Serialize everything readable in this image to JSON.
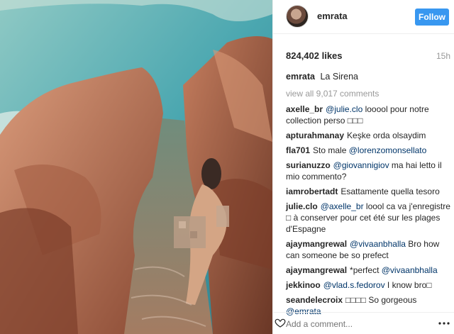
{
  "post": {
    "username": "emrata",
    "follow_label": "Follow",
    "likes": "824,402 likes",
    "time": "15h",
    "caption_user": "emrata",
    "caption_text": "La Sirena",
    "view_all": "view all 9,017 comments",
    "add_comment_placeholder": "Add a comment..."
  },
  "comments": [
    {
      "user": "axelle_br",
      "mention": "@julie.clo",
      "text": " looool pour notre collection perso □□□"
    },
    {
      "user": "apturahmanay",
      "mention": "",
      "text": "Keşke orda olsaydim"
    },
    {
      "user": "fla701",
      "mention": "@lorenzomonsellato",
      "text_before": "Sto male ",
      "text": ""
    },
    {
      "user": "surianuzzo",
      "mention": "@giovannigiov",
      "text": " ma hai letto il mio commento?"
    },
    {
      "user": "iamrobertadt",
      "mention": "",
      "text": "Esattamente quella tesoro"
    },
    {
      "user": "julie.clo",
      "mention": "@axelle_br",
      "text": " loool ca va j'enregistre □ à conserver pour cet été sur les plages d'Espagne"
    },
    {
      "user": "ajaymangrewal",
      "mention": "@vivaanbhalla",
      "text": " Bro how can someone be so prefect"
    },
    {
      "user": "ajaymangrewal",
      "mention": "@vivaanbhalla",
      "text_before": "*perfect ",
      "text": ""
    },
    {
      "user": "jekkinoo",
      "mention": "@vlad.s.fedorov",
      "text": " I know bro□"
    },
    {
      "user": "seandelecroix",
      "mention": "@emrata",
      "text_before": "□□□□ So gorgeous ",
      "text": ""
    }
  ],
  "colors": {
    "follow": "#3897f0",
    "mention": "#003569",
    "muted": "#999999"
  },
  "icons": {
    "like": "heart-icon",
    "more": "more-options-icon"
  }
}
